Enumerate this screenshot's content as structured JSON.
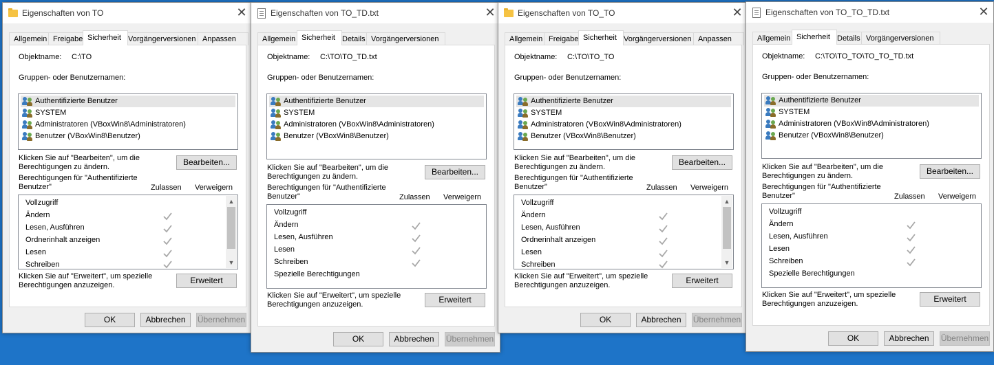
{
  "common": {
    "label_objectname": "Objektname:",
    "label_groups": "Gruppen- oder Benutzernamen:",
    "edit_hint": "Klicken Sie auf \"Bearbeiten\", um die Berechtigungen zu ändern.",
    "edit_button": "Bearbeiten...",
    "perm_for": "Berechtigungen für \"Authentifizierte Benutzer\"",
    "col_allow": "Zulassen",
    "col_deny": "Verweigern",
    "adv_hint": "Klicken Sie auf \"Erweitert\", um spezielle Berechtigungen anzuzeigen.",
    "adv_button": "Erweitert",
    "ok": "OK",
    "cancel": "Abbrechen",
    "apply": "Übernehmen",
    "users": [
      "Authentifizierte Benutzer",
      "SYSTEM",
      "Administratoren (VBoxWin8\\Administratoren)",
      "Benutzer (VBoxWin8\\Benutzer)"
    ],
    "perms_folder": [
      "Vollzugriff",
      "Ändern",
      "Lesen, Ausführen",
      "Ordnerinhalt anzeigen",
      "Lesen",
      "Schreiben"
    ],
    "perms_file": [
      "Vollzugriff",
      "Ändern",
      "Lesen, Ausführen",
      "Lesen",
      "Schreiben",
      "Spezielle Berechtigungen"
    ],
    "allow_folder": [
      false,
      true,
      true,
      true,
      true,
      true
    ],
    "allow_file": [
      false,
      true,
      true,
      true,
      true,
      false
    ]
  },
  "windows": [
    {
      "title": "Eigenschaften von TO",
      "object": "C:\\TO",
      "tabs": [
        "Allgemein",
        "Freigabe",
        "Sicherheit",
        "Vorgängerversionen",
        "Anpassen"
      ]
    },
    {
      "title": "Eigenschaften von TO_TD.txt",
      "object": "C:\\TO\\TO_TD.txt",
      "tabs": [
        "Allgemein",
        "Sicherheit",
        "Details",
        "Vorgängerversionen"
      ]
    },
    {
      "title": "Eigenschaften von TO_TO",
      "object": "C:\\TO\\TO_TO",
      "tabs": [
        "Allgemein",
        "Freigabe",
        "Sicherheit",
        "Vorgängerversionen",
        "Anpassen"
      ]
    },
    {
      "title": "Eigenschaften von TO_TO_TD.txt",
      "object": "C:\\TO\\TO_TO\\TO_TO_TD.txt",
      "tabs": [
        "Allgemein",
        "Sicherheit",
        "Details",
        "Vorgängerversionen"
      ]
    }
  ]
}
